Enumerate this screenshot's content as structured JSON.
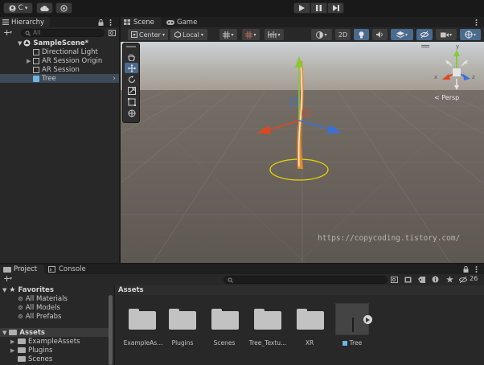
{
  "toolbar": {
    "account_label": "C",
    "account_caret": "▾"
  },
  "hierarchy": {
    "tab_label": "Hierarchy",
    "add_label": "+",
    "search_placeholder": "All",
    "scene_name": "SampleScene*",
    "items": [
      {
        "label": "Directional Light",
        "icon": "gameobject-icon"
      },
      {
        "label": "AR Session Origin",
        "icon": "gameobject-icon",
        "expandable": true
      },
      {
        "label": "AR Session",
        "icon": "gameobject-icon"
      },
      {
        "label": "Tree",
        "icon": "prefab-icon",
        "selected": true
      }
    ]
  },
  "scene_view": {
    "tabs": [
      {
        "label": "Scene",
        "active": true,
        "icon": "scene-icon"
      },
      {
        "label": "Game",
        "active": false,
        "icon": "game-icon"
      }
    ],
    "pivot_label": "Center",
    "space_label": "Local",
    "mode_2d_label": "2D",
    "gizmo_axes": {
      "x": "x",
      "y": "y",
      "z": "z"
    },
    "persp_label": "< Persp",
    "watermark": "https://copycoding.tistory.com/",
    "colors": {
      "x_axis": "#e0461f",
      "y_axis": "#8ac935",
      "z_axis": "#3b6fd9",
      "ring": "#e8d400",
      "tree": "#e58a2a"
    }
  },
  "project": {
    "tabs": [
      {
        "label": "Project",
        "active": true,
        "icon": "folder-icon"
      },
      {
        "label": "Console",
        "active": false,
        "icon": "console-icon"
      }
    ],
    "add_label": "+",
    "hidden_count": "26",
    "sidebar": {
      "favorites_label": "Favorites",
      "favorites": [
        "All Materials",
        "All Models",
        "All Prefabs"
      ],
      "assets_label": "Assets",
      "assets_children": [
        "ExampleAssets",
        "Plugins",
        "Scenes"
      ]
    },
    "breadcrumb": "Assets",
    "assets": [
      {
        "label": "ExampleAs...",
        "type": "folder"
      },
      {
        "label": "Plugins",
        "type": "folder"
      },
      {
        "label": "Scenes",
        "type": "folder"
      },
      {
        "label": "Tree_Textu...",
        "type": "folder"
      },
      {
        "label": "XR",
        "type": "folder"
      },
      {
        "label": "Tree",
        "type": "prefab"
      }
    ]
  }
}
